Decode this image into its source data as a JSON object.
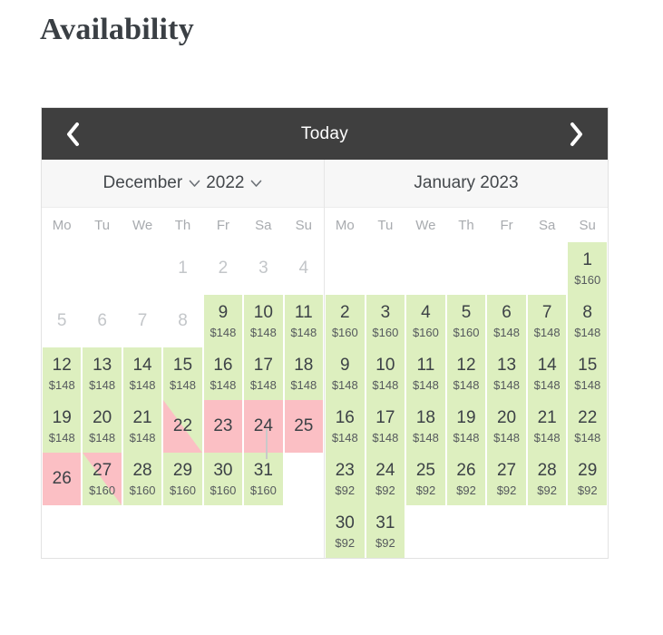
{
  "page": {
    "title": "Availability"
  },
  "colors": {
    "available": "#ddefbf",
    "unavailable": "#fbbfc4",
    "nav_bar": "#3f3f3f",
    "month_head": "#f7f7f7",
    "muted_text": "#c3c6c9"
  },
  "nav": {
    "today_label": "Today",
    "prev_icon": "chevron-left-icon",
    "next_icon": "chevron-right-icon"
  },
  "weekdays": [
    "Mo",
    "Tu",
    "We",
    "Th",
    "Fr",
    "Sa",
    "Su"
  ],
  "months": [
    {
      "id": "december-2022",
      "month_label": "December",
      "year_label": "2022",
      "has_dropdowns": true,
      "dropdown_icon": "chevron-down-icon",
      "weeks": [
        [
          {
            "day": "",
            "price": "",
            "state": "empty"
          },
          {
            "day": "",
            "price": "",
            "state": "empty"
          },
          {
            "day": "",
            "price": "",
            "state": "empty"
          },
          {
            "day": "",
            "price": "",
            "state": "empty"
          },
          {
            "day": "1",
            "price": "",
            "state": "muted"
          },
          {
            "day": "2",
            "price": "",
            "state": "muted"
          },
          {
            "day": "3",
            "price": "",
            "state": "muted"
          },
          {
            "day": "4",
            "price": "",
            "state": "muted"
          }
        ],
        [
          {
            "day": "5",
            "price": "",
            "state": "muted"
          },
          {
            "day": "6",
            "price": "",
            "state": "muted"
          },
          {
            "day": "7",
            "price": "",
            "state": "muted"
          },
          {
            "day": "8",
            "price": "",
            "state": "muted"
          },
          {
            "day": "9",
            "price": "$148",
            "state": "available"
          },
          {
            "day": "10",
            "price": "$148",
            "state": "available"
          },
          {
            "day": "11",
            "price": "$148",
            "state": "available"
          }
        ],
        [
          {
            "day": "12",
            "price": "$148",
            "state": "available"
          },
          {
            "day": "13",
            "price": "$148",
            "state": "available"
          },
          {
            "day": "14",
            "price": "$148",
            "state": "available"
          },
          {
            "day": "15",
            "price": "$148",
            "state": "available"
          },
          {
            "day": "16",
            "price": "$148",
            "state": "available"
          },
          {
            "day": "17",
            "price": "$148",
            "state": "available"
          },
          {
            "day": "18",
            "price": "$148",
            "state": "available"
          }
        ],
        [
          {
            "day": "19",
            "price": "$148",
            "state": "available"
          },
          {
            "day": "20",
            "price": "$148",
            "state": "available"
          },
          {
            "day": "21",
            "price": "$148",
            "state": "available"
          },
          {
            "day": "22",
            "price": "",
            "state": "split-checkout"
          },
          {
            "day": "23",
            "price": "",
            "state": "unavailable"
          },
          {
            "day": "24",
            "price": "",
            "state": "unavailable"
          },
          {
            "day": "25",
            "price": "",
            "state": "unavailable"
          }
        ],
        [
          {
            "day": "26",
            "price": "",
            "state": "unavailable"
          },
          {
            "day": "27",
            "price": "$160",
            "state": "split-checkin"
          },
          {
            "day": "28",
            "price": "$160",
            "state": "available"
          },
          {
            "day": "29",
            "price": "$160",
            "state": "available"
          },
          {
            "day": "30",
            "price": "$160",
            "state": "available"
          },
          {
            "day": "31",
            "price": "$160",
            "state": "available"
          },
          {
            "day": "",
            "price": "",
            "state": "empty"
          }
        ],
        [
          {
            "day": "",
            "price": "",
            "state": "empty"
          },
          {
            "day": "",
            "price": "",
            "state": "empty"
          },
          {
            "day": "",
            "price": "",
            "state": "empty"
          },
          {
            "day": "",
            "price": "",
            "state": "empty"
          },
          {
            "day": "",
            "price": "",
            "state": "empty"
          },
          {
            "day": "",
            "price": "",
            "state": "empty"
          },
          {
            "day": "",
            "price": "",
            "state": "empty"
          }
        ]
      ]
    },
    {
      "id": "january-2023",
      "month_label": "January 2023",
      "year_label": "",
      "has_dropdowns": false,
      "weeks": [
        [
          {
            "day": "",
            "price": "",
            "state": "empty"
          },
          {
            "day": "",
            "price": "",
            "state": "empty"
          },
          {
            "day": "",
            "price": "",
            "state": "empty"
          },
          {
            "day": "",
            "price": "",
            "state": "empty"
          },
          {
            "day": "",
            "price": "",
            "state": "empty"
          },
          {
            "day": "",
            "price": "",
            "state": "empty"
          },
          {
            "day": "1",
            "price": "$160",
            "state": "available"
          }
        ],
        [
          {
            "day": "2",
            "price": "$160",
            "state": "available"
          },
          {
            "day": "3",
            "price": "$160",
            "state": "available"
          },
          {
            "day": "4",
            "price": "$160",
            "state": "available"
          },
          {
            "day": "5",
            "price": "$160",
            "state": "available"
          },
          {
            "day": "6",
            "price": "$148",
            "state": "available"
          },
          {
            "day": "7",
            "price": "$148",
            "state": "available"
          },
          {
            "day": "8",
            "price": "$148",
            "state": "available"
          }
        ],
        [
          {
            "day": "9",
            "price": "$148",
            "state": "available"
          },
          {
            "day": "10",
            "price": "$148",
            "state": "available"
          },
          {
            "day": "11",
            "price": "$148",
            "state": "available"
          },
          {
            "day": "12",
            "price": "$148",
            "state": "available"
          },
          {
            "day": "13",
            "price": "$148",
            "state": "available"
          },
          {
            "day": "14",
            "price": "$148",
            "state": "available"
          },
          {
            "day": "15",
            "price": "$148",
            "state": "available"
          }
        ],
        [
          {
            "day": "16",
            "price": "$148",
            "state": "available"
          },
          {
            "day": "17",
            "price": "$148",
            "state": "available"
          },
          {
            "day": "18",
            "price": "$148",
            "state": "available"
          },
          {
            "day": "19",
            "price": "$148",
            "state": "available"
          },
          {
            "day": "20",
            "price": "$148",
            "state": "available"
          },
          {
            "day": "21",
            "price": "$148",
            "state": "available"
          },
          {
            "day": "22",
            "price": "$148",
            "state": "available"
          }
        ],
        [
          {
            "day": "23",
            "price": "$92",
            "state": "available"
          },
          {
            "day": "24",
            "price": "$92",
            "state": "available"
          },
          {
            "day": "25",
            "price": "$92",
            "state": "available"
          },
          {
            "day": "26",
            "price": "$92",
            "state": "available"
          },
          {
            "day": "27",
            "price": "$92",
            "state": "available"
          },
          {
            "day": "28",
            "price": "$92",
            "state": "available"
          },
          {
            "day": "29",
            "price": "$92",
            "state": "available"
          }
        ],
        [
          {
            "day": "30",
            "price": "$92",
            "state": "available"
          },
          {
            "day": "31",
            "price": "$92",
            "state": "available"
          },
          {
            "day": "",
            "price": "",
            "state": "empty"
          },
          {
            "day": "",
            "price": "",
            "state": "empty"
          },
          {
            "day": "",
            "price": "",
            "state": "empty"
          },
          {
            "day": "",
            "price": "",
            "state": "empty"
          },
          {
            "day": "",
            "price": "",
            "state": "empty"
          }
        ]
      ]
    }
  ]
}
